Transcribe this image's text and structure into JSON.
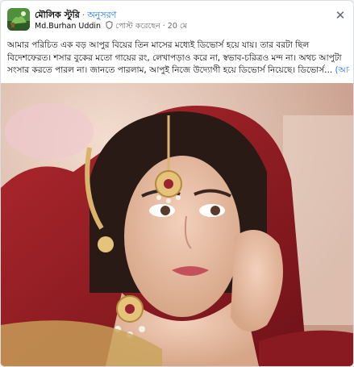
{
  "post": {
    "page_name": "মৌলিক স্টুরি",
    "follow_label": "অনুসরণ",
    "author": "Md.Burhan Uddin",
    "posted_label": "পোস্ট করেছেন",
    "time": "20 মে",
    "close_icon": "close-icon",
    "text_lines": [
      "আমার পরিচিত এক বড় আপুর বিয়ের তিন মাসের মধ্যেই ডিভোর্স হয়ে যায়। তার বরটা ছিল",
      "বিদেশফেরত। শসার বুকের মতো গায়ের রং, লেখাপড়াও করে না, স্বভাব-চরিত্রও মন্দ না। অথচ আপুটা",
      "সংসার করতে পারল না। জানতে পারলাম, আপুই নিজে উদ্যোগী হয়ে ডিভোর্স নিয়েছে। ডিভোর্স..."
    ],
    "see_more": "(আরও)"
  },
  "colors": {
    "link": "#1877f2",
    "secondary_text": "#65676b"
  }
}
